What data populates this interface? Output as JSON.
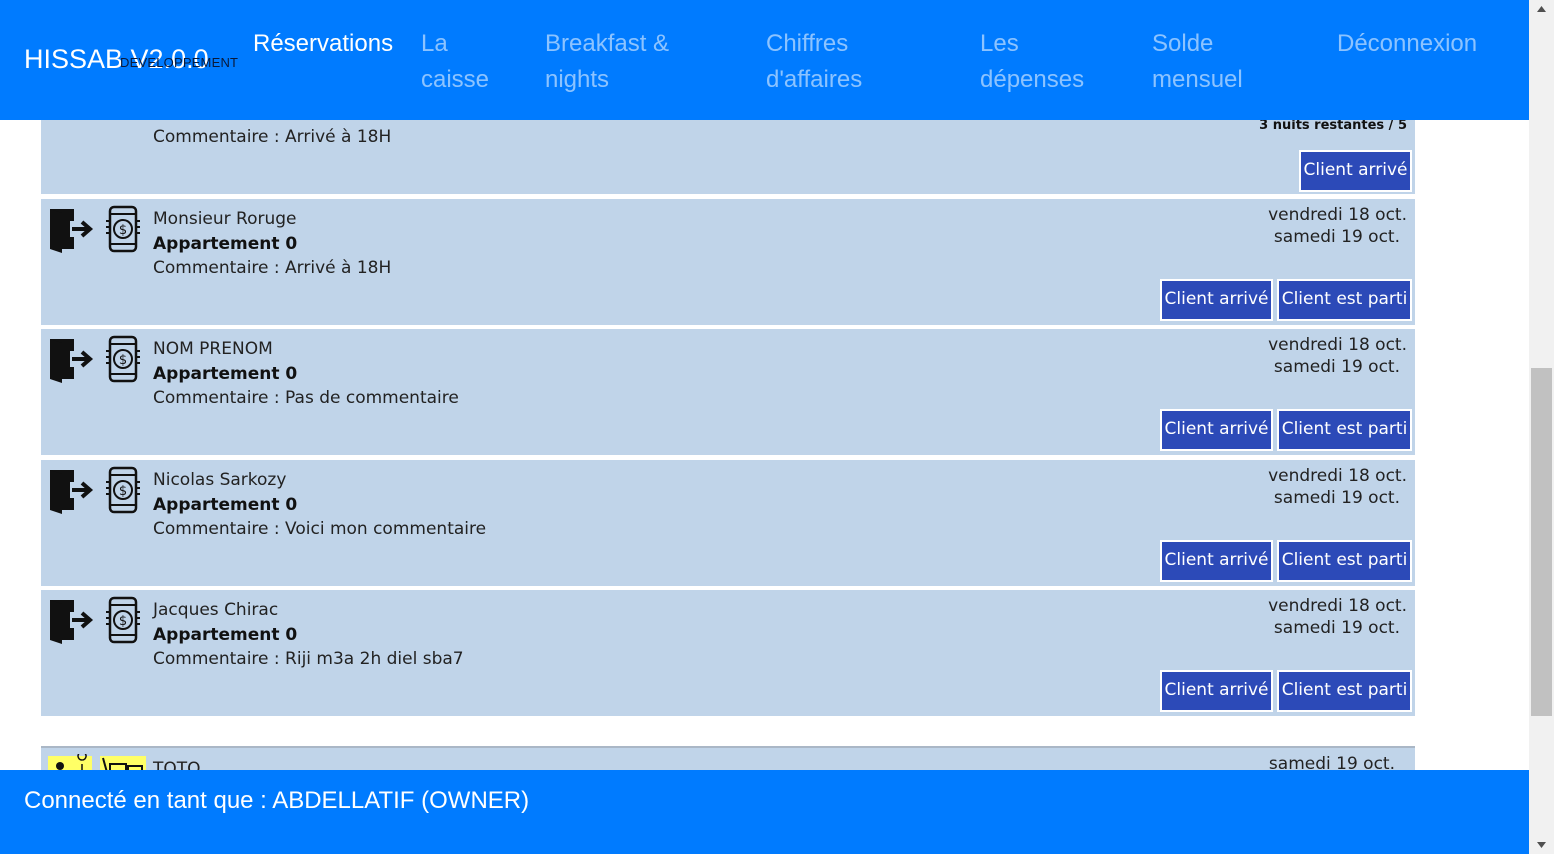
{
  "header": {
    "brand": "HISSAB V2.0.0",
    "brand_sub": "DEVELOPPEMENT",
    "nav": [
      {
        "label": "Réservations",
        "active": true
      },
      {
        "label": "La caisse",
        "active": false
      },
      {
        "label": "Breakfast & nights",
        "active": false
      },
      {
        "label": "Chiffres d'affaires",
        "active": false
      },
      {
        "label": "Les dépenses",
        "active": false
      },
      {
        "label": "Solde mensuel",
        "active": false
      },
      {
        "label": "Déconnexion",
        "active": false
      }
    ]
  },
  "top_card": {
    "nights": "3 nuits restantes / 5",
    "comment": "Commentaire : Arrivé à 18H",
    "arrive_label": "Client arrivé"
  },
  "reservations": [
    {
      "name": "Monsieur Roruge",
      "apartment": "Appartement 0",
      "comment": "Commentaire : Arrivé à 18H",
      "date_in": "vendredi 18 oct.",
      "date_out": "samedi 19 oct.",
      "arrive_label": "Client arrivé",
      "depart_label": "Client est parti"
    },
    {
      "name": "NOM PRENOM",
      "apartment": "Appartement 0",
      "comment": "Commentaire : Pas de commentaire",
      "date_in": "vendredi 18 oct.",
      "date_out": "samedi 19 oct.",
      "arrive_label": "Client arrivé",
      "depart_label": "Client est parti"
    },
    {
      "name": "Nicolas Sarkozy",
      "apartment": "Appartement 0",
      "comment": "Commentaire : Voici mon commentaire",
      "date_in": "vendredi 18 oct.",
      "date_out": "samedi 19 oct.",
      "arrive_label": "Client arrivé",
      "depart_label": "Client est parti"
    },
    {
      "name": "Jacques Chirac",
      "apartment": "Appartement 0",
      "comment": "Commentaire : Riji m3a 2h diel sba7",
      "date_in": "vendredi 18 oct.",
      "date_out": "samedi 19 oct.",
      "arrive_label": "Client arrivé",
      "depart_label": "Client est parti"
    }
  ],
  "bottom_card": {
    "name": "TOTO",
    "date": "samedi 19 oct."
  },
  "footer": {
    "text": "Connecté en tant que : ABDELLATIF (OWNER)"
  },
  "colors": {
    "header_bg": "#007bff",
    "card_bg": "#c0d4e9",
    "button_bg": "#2c4ab8",
    "highlight_yellow": "#ffff66"
  },
  "icons": [
    "door-exit-icon",
    "phone-payment-icon",
    "person-pin-icon",
    "hand-phone-icon"
  ]
}
